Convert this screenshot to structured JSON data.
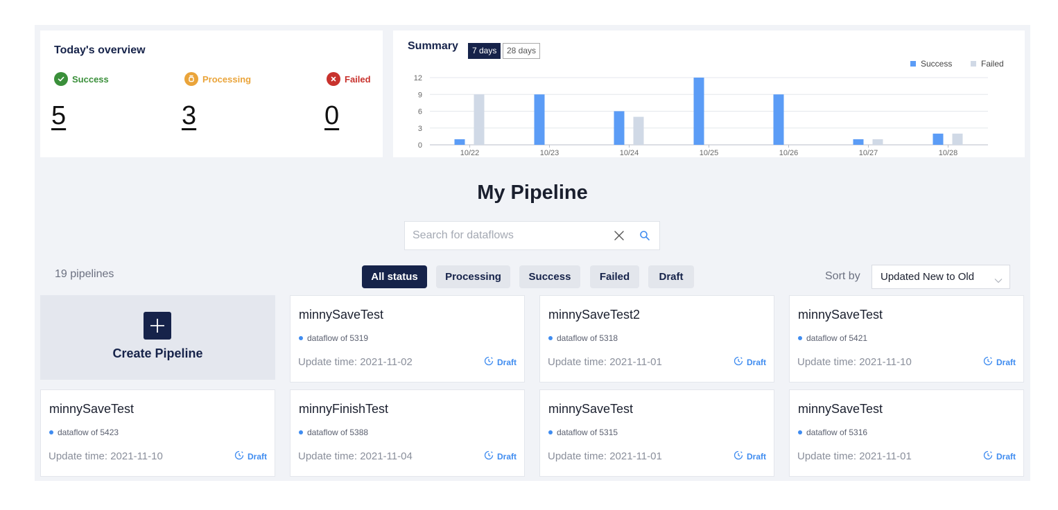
{
  "overview": {
    "title": "Today's overview",
    "stats": [
      {
        "label": "Success",
        "value": "5",
        "color": "#3a8f3a",
        "icon": "check-circle-icon"
      },
      {
        "label": "Processing",
        "value": "3",
        "color": "#eaa43a",
        "icon": "hourglass-icon"
      },
      {
        "label": "Failed",
        "value": "0",
        "color": "#c8322d",
        "icon": "x-circle-icon"
      }
    ]
  },
  "summary": {
    "title": "Summary",
    "ranges": [
      "7 days",
      "28 days"
    ],
    "selected_range": "7 days"
  },
  "chart_data": {
    "type": "bar",
    "categories": [
      "10/22",
      "10/23",
      "10/24",
      "10/25",
      "10/26",
      "10/27",
      "10/28"
    ],
    "series": [
      {
        "name": "Success",
        "values": [
          1,
          9,
          6,
          12,
          9,
          1,
          2
        ],
        "color": "#5b9cf6"
      },
      {
        "name": "Failed",
        "values": [
          9,
          0,
          5,
          0,
          0,
          1,
          2
        ],
        "color": "#d0d9e6"
      }
    ],
    "yticks": [
      "0",
      "3",
      "6",
      "9",
      "12"
    ],
    "ylim": [
      0,
      12
    ],
    "grid": true,
    "legend": "top-right"
  },
  "page": {
    "title": "My Pipeline",
    "search_placeholder": "Search for dataflows",
    "count_label": "19 pipelines",
    "filters": [
      "All status",
      "Processing",
      "Success",
      "Failed",
      "Draft"
    ],
    "active_filter": "All status",
    "sort_label": "Sort by",
    "sort_value": "Updated New to Old",
    "create_label": "Create Pipeline"
  },
  "pipelines": [
    {
      "name": "minnySaveTest",
      "flow": "dataflow of 5319",
      "time": "Update time: 2021-11-02",
      "status": "Draft"
    },
    {
      "name": "minnySaveTest2",
      "flow": "dataflow of 5318",
      "time": "Update time: 2021-11-01",
      "status": "Draft"
    },
    {
      "name": "minnySaveTest",
      "flow": "dataflow of 5421",
      "time": "Update time: 2021-11-10",
      "status": "Draft"
    },
    {
      "name": "minnySaveTest",
      "flow": "dataflow of 5423",
      "time": "Update time: 2021-11-10",
      "status": "Draft"
    },
    {
      "name": "minnyFinishTest",
      "flow": "dataflow of 5388",
      "time": "Update time: 2021-11-04",
      "status": "Draft"
    },
    {
      "name": "minnySaveTest",
      "flow": "dataflow of 5315",
      "time": "Update time: 2021-11-01",
      "status": "Draft"
    },
    {
      "name": "minnySaveTest",
      "flow": "dataflow of 5316",
      "time": "Update time: 2021-11-01",
      "status": "Draft"
    }
  ]
}
